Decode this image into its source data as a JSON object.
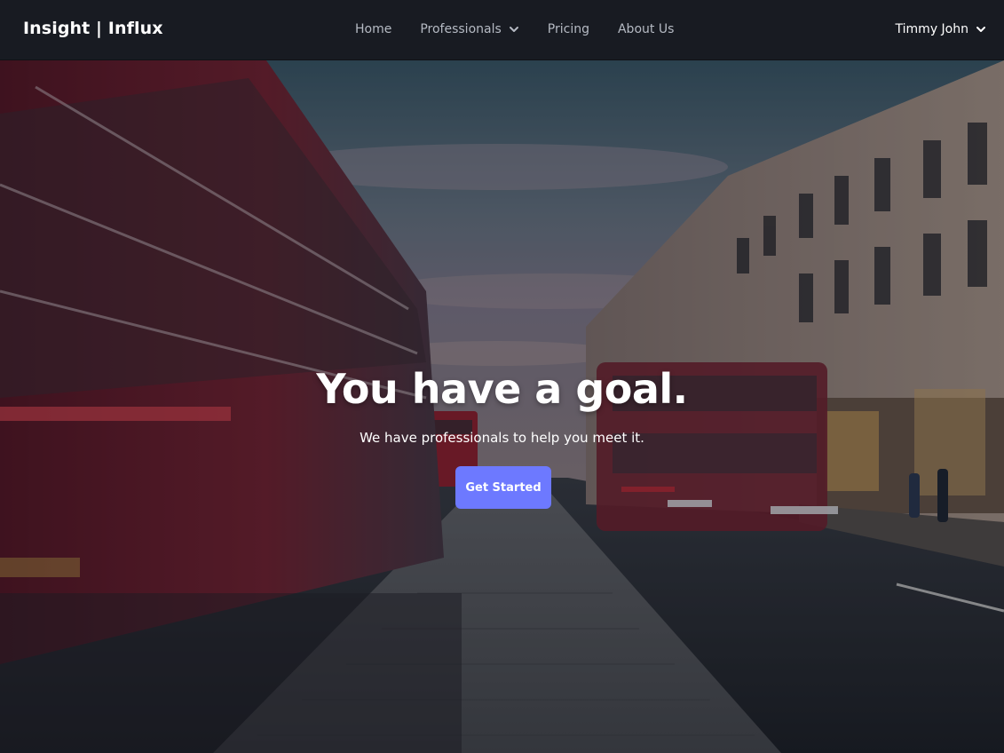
{
  "brand": "Insight | Influx",
  "nav": {
    "home": "Home",
    "professionals": "Professionals",
    "pricing": "Pricing",
    "about": "About Us"
  },
  "user": {
    "name": "Timmy John"
  },
  "hero": {
    "title": "You have a goal.",
    "subtitle": "We have professionals to help you meet it.",
    "cta_label": "Get Started"
  },
  "colors": {
    "navbar": "#181b22",
    "accent": "#6d79ff",
    "text_light": "#ffffff",
    "nav_text": "#b5bac3"
  }
}
